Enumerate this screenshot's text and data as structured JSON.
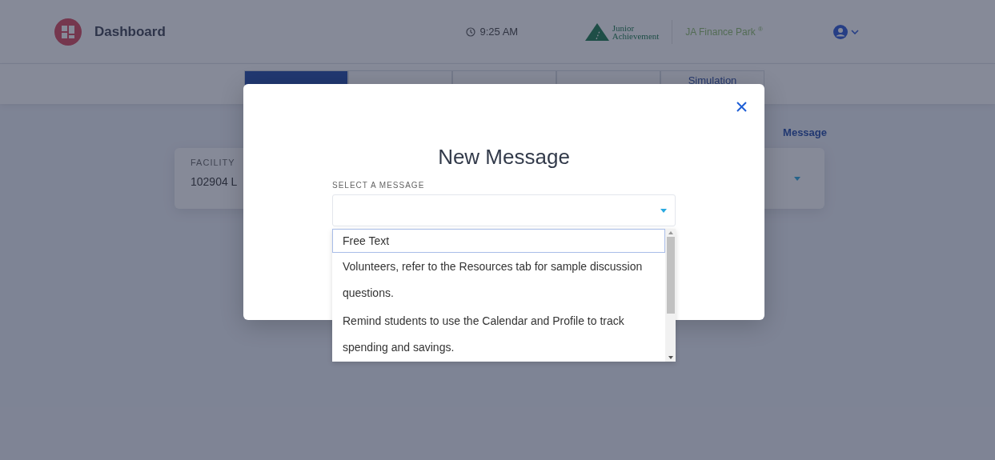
{
  "header": {
    "title": "Dashboard",
    "time": "9:25 AM",
    "logo_text": [
      "Junior",
      "Achievement"
    ],
    "brand": "JA Finance Park",
    "brand_mark": "®"
  },
  "tabs": [
    {
      "selected": true
    },
    {
      "selected": false
    },
    {
      "selected": false
    },
    {
      "selected": false
    },
    {
      "label": "Simulation",
      "selected": false
    }
  ],
  "page": {
    "link": "Message",
    "facility": {
      "label": "FACILITY",
      "value": "102904 L"
    }
  },
  "modal": {
    "title": "New Message",
    "select_label": "SELECT A MESSAGE",
    "options": [
      {
        "text": "Free Text",
        "selected": true
      },
      {
        "text": "Volunteers, refer to the Resources tab for sample discussion questions.",
        "selected": false
      },
      {
        "text": "Remind students to use the Calendar and Profile to track spending and savings.",
        "selected": false
      }
    ]
  }
}
